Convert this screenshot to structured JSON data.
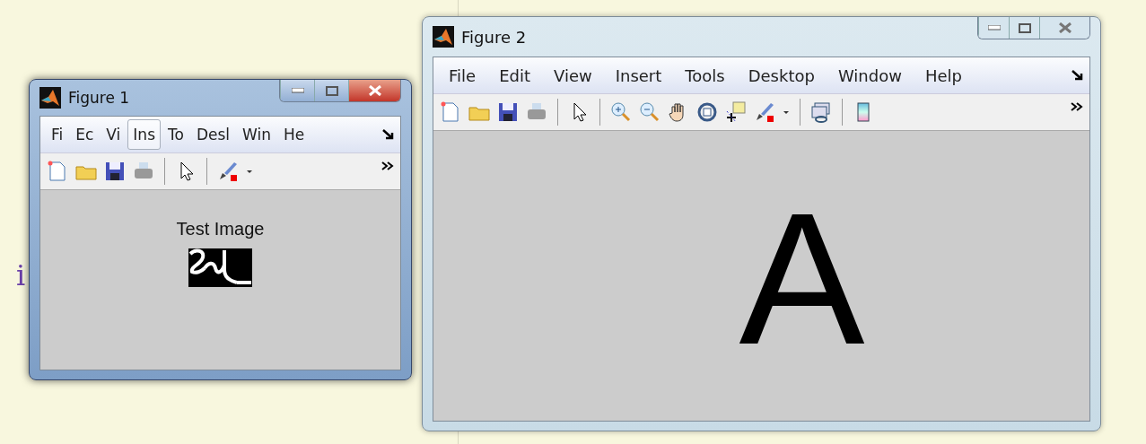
{
  "background_text": "i",
  "windows": [
    {
      "title": "Figure 1",
      "active": true,
      "menu": [
        {
          "label": "Fi",
          "highlighted": false
        },
        {
          "label": "Ec",
          "highlighted": false
        },
        {
          "label": "Vi",
          "highlighted": false
        },
        {
          "label": "Ins",
          "highlighted": true
        },
        {
          "label": "To",
          "highlighted": false
        },
        {
          "label": "Desl",
          "highlighted": false
        },
        {
          "label": "Win",
          "highlighted": false
        },
        {
          "label": "He",
          "highlighted": false
        }
      ],
      "tools": [
        {
          "kind": "new"
        },
        {
          "kind": "open"
        },
        {
          "kind": "save"
        },
        {
          "kind": "print"
        },
        {
          "kind": "separator"
        },
        {
          "kind": "pointer"
        },
        {
          "kind": "separator"
        },
        {
          "kind": "brush"
        },
        {
          "kind": "dropdown"
        }
      ],
      "content": {
        "title": "Test Image"
      }
    },
    {
      "title": "Figure 2",
      "active": false,
      "menu": [
        {
          "label": "File",
          "highlighted": false
        },
        {
          "label": "Edit",
          "highlighted": false
        },
        {
          "label": "View",
          "highlighted": false
        },
        {
          "label": "Insert",
          "highlighted": false
        },
        {
          "label": "Tools",
          "highlighted": false
        },
        {
          "label": "Desktop",
          "highlighted": false
        },
        {
          "label": "Window",
          "highlighted": false
        },
        {
          "label": "Help",
          "highlighted": false
        }
      ],
      "tools": [
        {
          "kind": "new"
        },
        {
          "kind": "open"
        },
        {
          "kind": "save"
        },
        {
          "kind": "print"
        },
        {
          "kind": "separator"
        },
        {
          "kind": "pointer"
        },
        {
          "kind": "separator"
        },
        {
          "kind": "zoom-in"
        },
        {
          "kind": "zoom-out"
        },
        {
          "kind": "pan"
        },
        {
          "kind": "rotate"
        },
        {
          "kind": "datatip"
        },
        {
          "kind": "brush"
        },
        {
          "kind": "dropdown"
        },
        {
          "kind": "separator"
        },
        {
          "kind": "link"
        },
        {
          "kind": "separator"
        },
        {
          "kind": "colorbar"
        }
      ],
      "content": {
        "kind": "letter",
        "text": "A"
      }
    }
  ]
}
